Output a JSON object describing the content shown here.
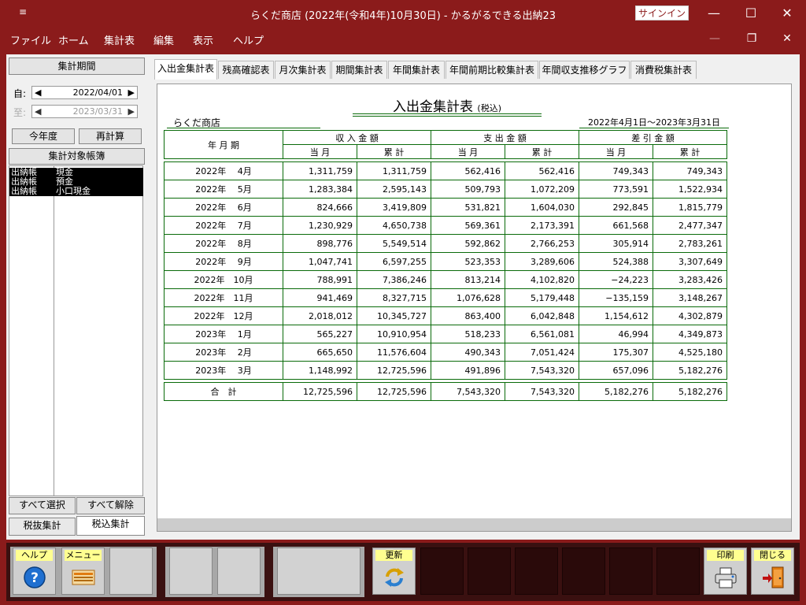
{
  "window": {
    "title": "らくだ商店 (2022年(令和4年)10月30日)  -  かるがるできる出納23",
    "signin": "サインイン",
    "menu_icon": "≡",
    "minimize": "—",
    "maximize": "☐",
    "close": "✕"
  },
  "menu": {
    "items": [
      "ファイル",
      "ホーム",
      "集計表",
      "編集",
      "表示",
      "ヘルプ"
    ],
    "mdi_min": "—",
    "mdi_restore": "❐",
    "mdi_close": "✕"
  },
  "left": {
    "period_button": "集計期間",
    "from_label": "自:",
    "from_date": "2022/04/01",
    "to_label": "至:",
    "to_date": "2023/03/31",
    "this_year": "今年度",
    "recalc": "再計算",
    "target_books": "集計対象帳簿",
    "books": [
      [
        "出納帳",
        "現金"
      ],
      [
        "出納帳",
        "預金"
      ],
      [
        "出納帳",
        "小口現金"
      ]
    ],
    "select_all": "すべて選択",
    "deselect_all": "すべて解除",
    "tax_excl": "税抜集計",
    "tax_incl": "税込集計"
  },
  "tabs": [
    "入出金集計表",
    "残高確認表",
    "月次集計表",
    "期間集計表",
    "年間集計表",
    "年間前期比較集計表",
    "年間収支推移グラフ",
    "消費税集計表"
  ],
  "report": {
    "title": "入出金集計表",
    "title_suffix": "(税込)",
    "shop": "らくだ商店",
    "period": "2022年4月1日～2023年3月31日",
    "headers": {
      "month": "年 月 期",
      "income": "収 入 金 額",
      "expense": "支 出 金 額",
      "diff": "差 引 金 額",
      "current": "当 月",
      "cumulative": "累 計"
    },
    "rows": [
      [
        "2022年　 4月",
        "1,311,759",
        "1,311,759",
        "562,416",
        "562,416",
        "749,343",
        "749,343"
      ],
      [
        "2022年　 5月",
        "1,283,384",
        "2,595,143",
        "509,793",
        "1,072,209",
        "773,591",
        "1,522,934"
      ],
      [
        "2022年　 6月",
        "824,666",
        "3,419,809",
        "531,821",
        "1,604,030",
        "292,845",
        "1,815,779"
      ],
      [
        "2022年　 7月",
        "1,230,929",
        "4,650,738",
        "569,361",
        "2,173,391",
        "661,568",
        "2,477,347"
      ],
      [
        "2022年　 8月",
        "898,776",
        "5,549,514",
        "592,862",
        "2,766,253",
        "305,914",
        "2,783,261"
      ],
      [
        "2022年　 9月",
        "1,047,741",
        "6,597,255",
        "523,353",
        "3,289,606",
        "524,388",
        "3,307,649"
      ],
      [
        "2022年　10月",
        "788,991",
        "7,386,246",
        "813,214",
        "4,102,820",
        "−24,223",
        "3,283,426"
      ],
      [
        "2022年　11月",
        "941,469",
        "8,327,715",
        "1,076,628",
        "5,179,448",
        "−135,159",
        "3,148,267"
      ],
      [
        "2022年　12月",
        "2,018,012",
        "10,345,727",
        "863,400",
        "6,042,848",
        "1,154,612",
        "4,302,879"
      ],
      [
        "2023年　 1月",
        "565,227",
        "10,910,954",
        "518,233",
        "6,561,081",
        "46,994",
        "4,349,873"
      ],
      [
        "2023年　 2月",
        "665,650",
        "11,576,604",
        "490,343",
        "7,051,424",
        "175,307",
        "4,525,180"
      ],
      [
        "2023年　 3月",
        "1,148,992",
        "12,725,596",
        "491,896",
        "7,543,320",
        "657,096",
        "5,182,276"
      ]
    ],
    "total": [
      "合　計",
      "12,725,596",
      "12,725,596",
      "7,543,320",
      "7,543,320",
      "5,182,276",
      "5,182,276"
    ]
  },
  "bottom": {
    "help": "ヘルプ",
    "menu": "メニュー",
    "update": "更新",
    "print": "印刷",
    "close": "閉じる"
  }
}
